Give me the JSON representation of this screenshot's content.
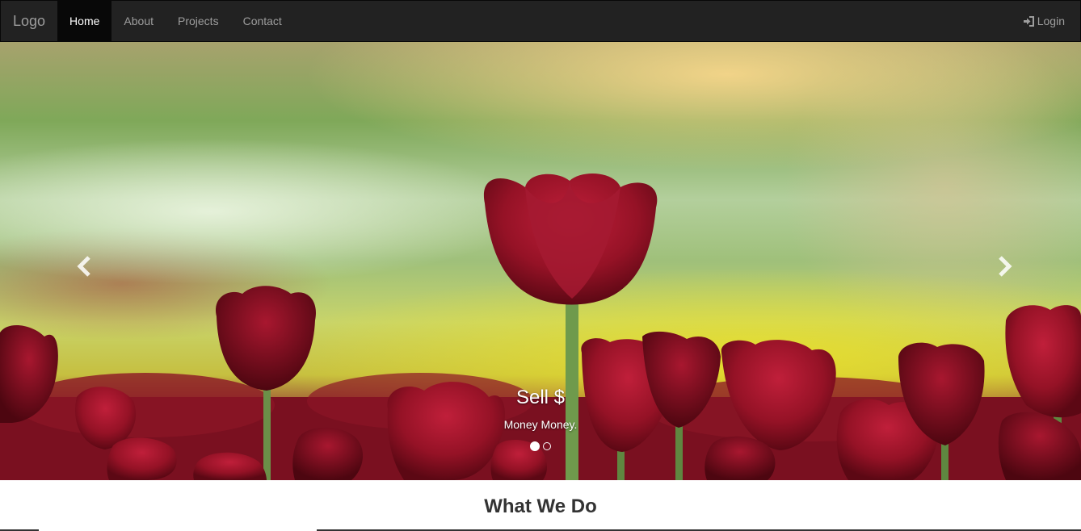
{
  "navbar": {
    "brand": "Logo",
    "links": [
      {
        "label": "Home"
      },
      {
        "label": "About"
      },
      {
        "label": "Projects"
      },
      {
        "label": "Contact"
      }
    ],
    "login_label": "Login",
    "login_icon": "log-in-icon",
    "active_color": "#080808",
    "bg_color": "#222222"
  },
  "carousel": {
    "prev_icon": "chevron-left-icon",
    "next_icon": "chevron-right-icon",
    "caption_title": "Sell $",
    "caption_text": "Money Money.",
    "slides_total": 2,
    "active_slide": 1
  },
  "section": {
    "title": "What We Do"
  }
}
